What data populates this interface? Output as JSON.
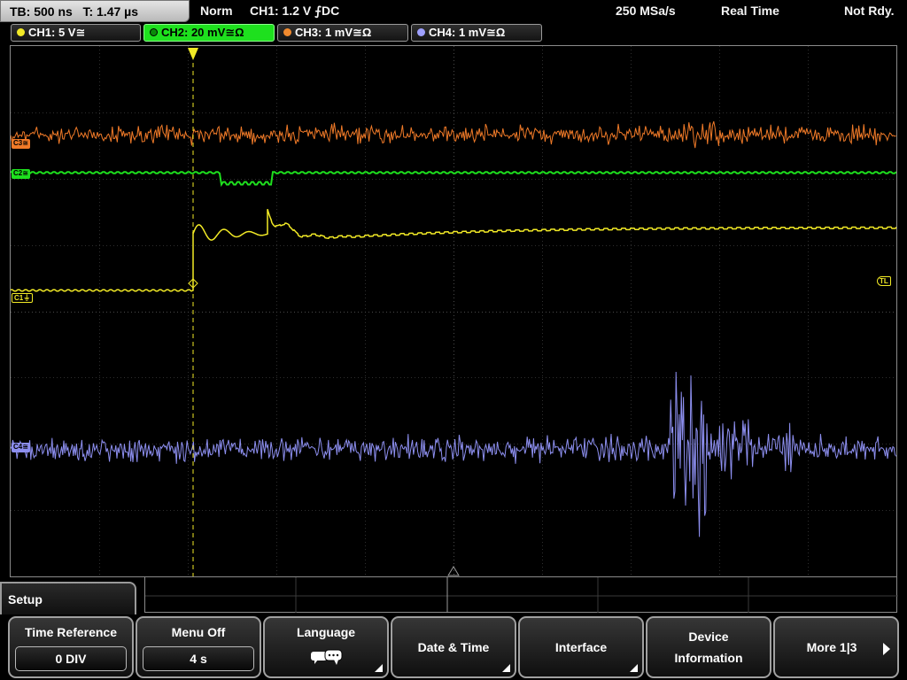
{
  "status": {
    "timebase": "TB: 500 ns   T: 1.47 µs",
    "mode": "Norm",
    "trigger": "CH1: 1.2 V ⨍DC",
    "sample_rate": "250 MSa/s",
    "acq_mode": "Real Time",
    "state": "Not Rdy."
  },
  "channels": [
    {
      "label": "CH1: 5 V≅",
      "color": "#f2ea26",
      "active": false
    },
    {
      "label": "CH2: 20 mV≅Ω",
      "color": "#1ee01e",
      "active": true
    },
    {
      "label": "CH3: 1 mV≅Ω",
      "color": "#f28a2e",
      "active": false
    },
    {
      "label": "CH4: 1 mV≅Ω",
      "color": "#9ea0ff",
      "active": false
    }
  ],
  "markers": {
    "ch3": "C3≅",
    "ch2": "C2≅",
    "ch1": "C1⏚",
    "ch4": "C4≅",
    "trigger_level": "TL"
  },
  "trace_colors": {
    "ch1": "#f2ea26",
    "ch2": "#1ee01e",
    "ch3": "#f07a28",
    "ch4": "#8d8ff0"
  },
  "menu": {
    "title": "Setup",
    "softkeys": [
      {
        "label": "Time Reference",
        "value": "0 DIV"
      },
      {
        "label": "Menu Off",
        "value": "4 s"
      },
      {
        "label": "Language",
        "icon": "speech-bubbles-icon"
      },
      {
        "label": "Date & Time"
      },
      {
        "label": "Interface"
      },
      {
        "label": "Device",
        "label2": "Information"
      },
      {
        "label": "More 1|3"
      }
    ]
  }
}
